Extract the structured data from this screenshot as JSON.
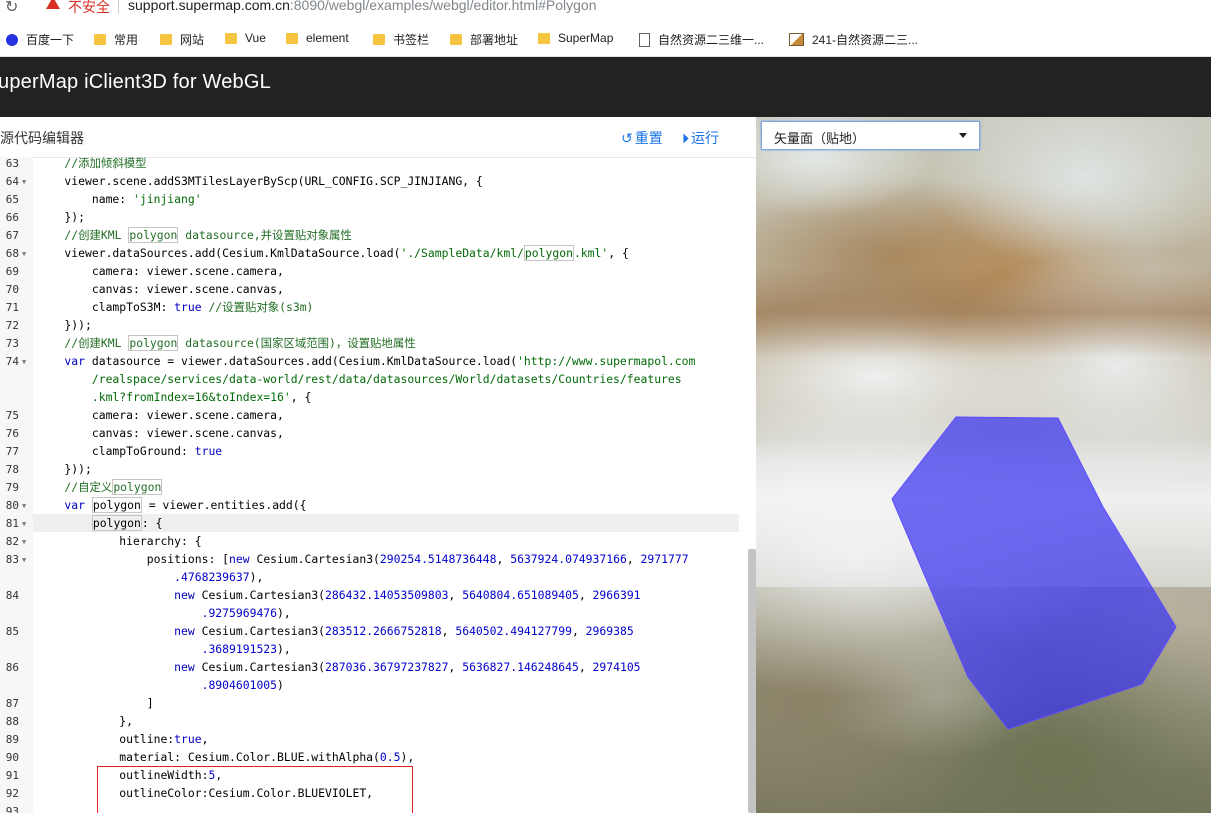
{
  "browser": {
    "security_label": "不安全",
    "url_host": "support.supermap.com.cn",
    "url_rest": ":8090/webgl/examples/webgl/editor.html#Polygon",
    "bookmarks": [
      "百度一下",
      "常用",
      "网站",
      "Vue",
      "element",
      "书签栏",
      "部署地址",
      "SuperMap",
      "自然资源二三维一...",
      "241-自然资源二三..."
    ]
  },
  "app": {
    "title": "uperMap iClient3D for WebGL"
  },
  "editor": {
    "title": "源代码编辑器",
    "reset_label": "重置",
    "run_label": "运行"
  },
  "map": {
    "layer_select": "矢量面（贴地）"
  },
  "code": {
    "line_numbers": [
      "63",
      "64",
      "65",
      "66",
      "67",
      "68",
      "69",
      "70",
      "71",
      "72",
      "73",
      "74",
      "",
      "",
      "75",
      "76",
      "77",
      "78",
      "79",
      "80",
      "81",
      "82",
      "83",
      "",
      "84",
      "",
      "85",
      "",
      "86",
      "",
      "87",
      "88",
      "89",
      "90",
      "91",
      "92",
      "93"
    ]
  }
}
